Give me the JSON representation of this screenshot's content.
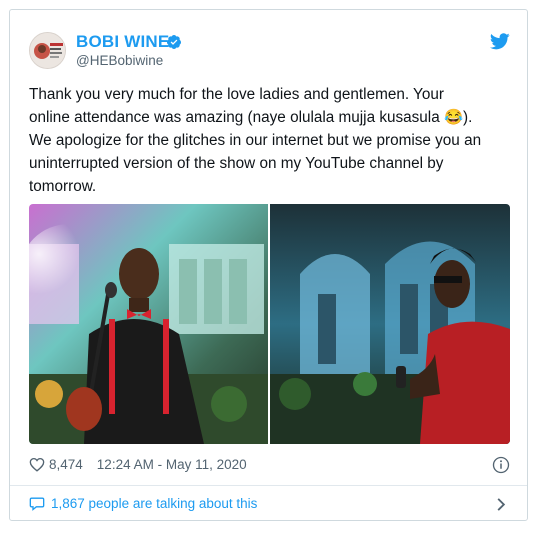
{
  "tweet": {
    "display_name": "BOBI WINE",
    "handle": "@HEBobiwine",
    "text_line1": "Thank you very much for the love ladies and gentlemen. Your",
    "text_line2": "online attendance was amazing (naye olulala mujja kusasula",
    "text_line3": "We apologize for the glitches in our internet but we promise you an",
    "text_line4": "uninterrupted version of the show on my YouTube channel by",
    "text_line5": "tomorrow.",
    "emoji": "😂",
    "likes": "8,474",
    "timestamp": "12:24 AM - May 11, 2020",
    "talking_about": "1,867 people are talking about this"
  },
  "colors": {
    "accent": "#1d9bf0",
    "text": "#0f1419",
    "muted": "#536471"
  },
  "icons": [
    "verified-badge-icon",
    "twitter-bird-icon",
    "heart-icon",
    "info-icon",
    "speech-bubble-icon",
    "chevron-right-icon"
  ]
}
